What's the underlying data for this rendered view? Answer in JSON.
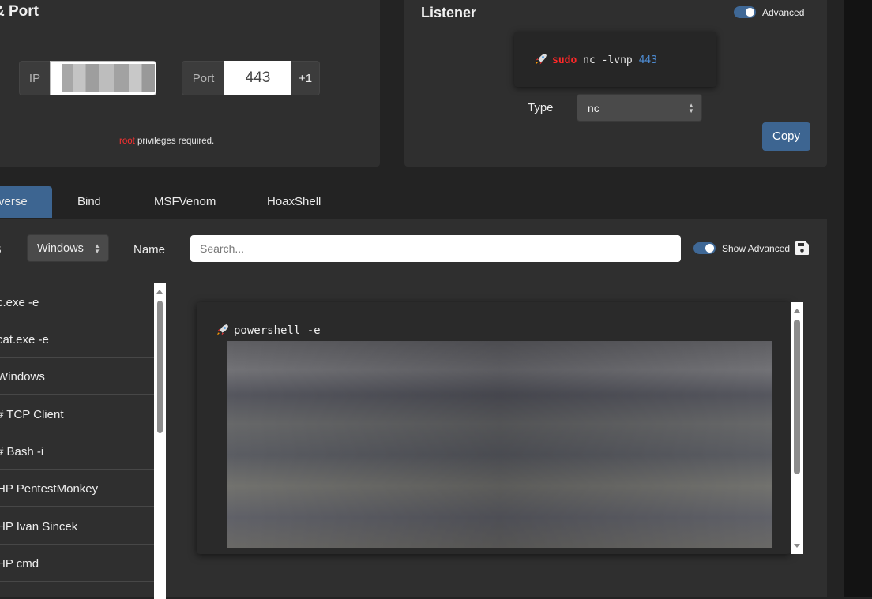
{
  "ip_port": {
    "title": "& Port",
    "ip_label": "IP",
    "port_label": "Port",
    "port_value": "443",
    "increment_label": "+1",
    "note_highlight": "root",
    "note_text": " privileges required."
  },
  "listener": {
    "title": "Listener",
    "advanced_label": "Advanced",
    "command": {
      "sudo": "sudo",
      "body": " nc -lvnp ",
      "port": "443"
    },
    "type_label": "Type",
    "type_value": "nc",
    "copy_label": "Copy"
  },
  "tabs": [
    {
      "label": "Reverse"
    },
    {
      "label": "Bind"
    },
    {
      "label": "MSFVenom"
    },
    {
      "label": "HoaxShell"
    }
  ],
  "tab_reverse_visible": "verse",
  "filters": {
    "os_label": "OS",
    "os_value": "Windows",
    "name_label": "Name",
    "search_placeholder": "Search...",
    "show_advanced_label": "Show Advanced"
  },
  "shell_list": [
    {
      "label": "c.exe -e"
    },
    {
      "label": "cat.exe -e"
    },
    {
      "label": " Windows"
    },
    {
      "label": "# TCP Client"
    },
    {
      "label": "# Bash -i"
    },
    {
      "label": "HP PentestMonkey"
    },
    {
      "label": "HP Ivan Sincek"
    },
    {
      "label": "HP cmd"
    }
  ],
  "output": {
    "command": "powershell -e"
  },
  "colors": {
    "accent": "#3d6591",
    "sudo": "#ff2828",
    "root": "#ff3030",
    "port": "#4d8ad0"
  },
  "icons": [
    "rocket-icon",
    "save-icon",
    "updown-arrow-icon"
  ]
}
